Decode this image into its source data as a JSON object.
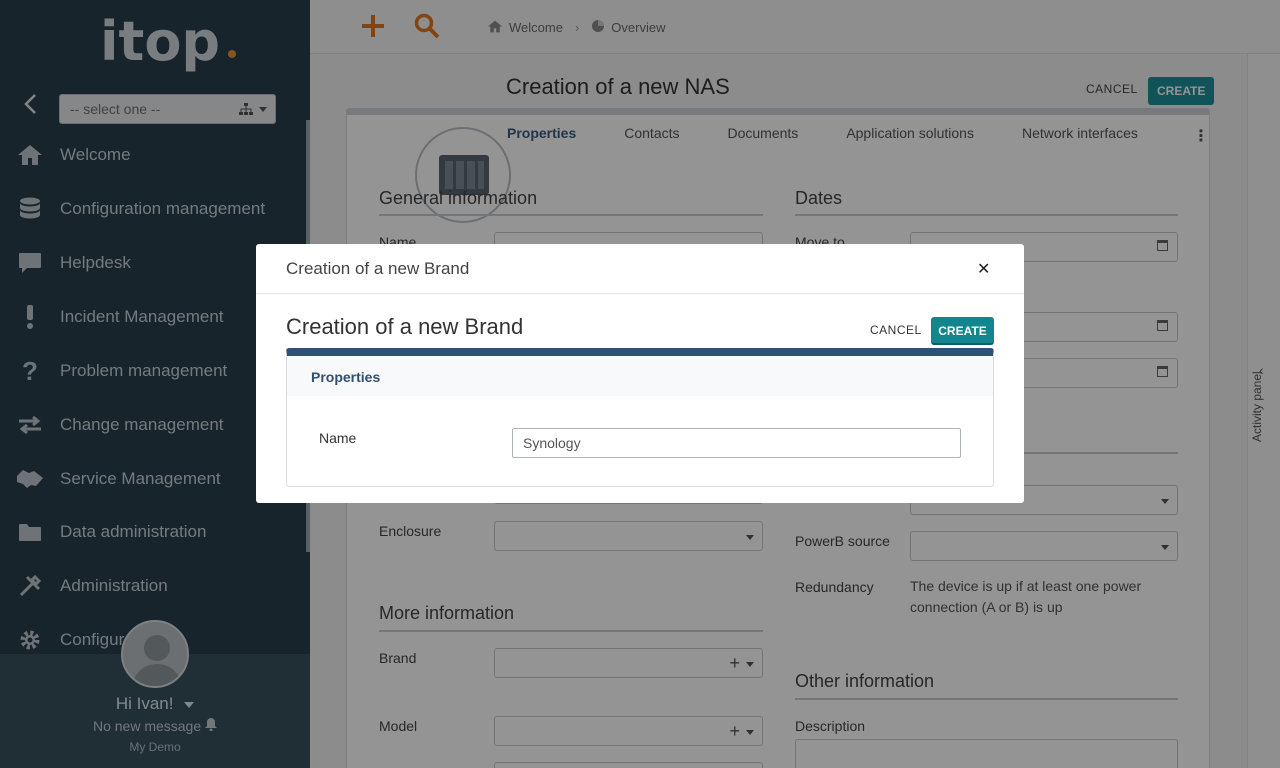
{
  "sidebar": {
    "logo_text": "itop",
    "org_select": "-- select one --",
    "menu": [
      {
        "label": "Welcome",
        "icon": "home-icon"
      },
      {
        "label": "Configuration management",
        "icon": "database-icon"
      },
      {
        "label": "Helpdesk",
        "icon": "chat-icon"
      },
      {
        "label": "Incident Management",
        "icon": "exclamation-icon"
      },
      {
        "label": "Problem management",
        "icon": "question-icon"
      },
      {
        "label": "Change management",
        "icon": "arrows-icon"
      },
      {
        "label": "Service Management",
        "icon": "handshake-icon"
      },
      {
        "label": "Data administration",
        "icon": "folder-icon"
      },
      {
        "label": "Administration",
        "icon": "tools-icon"
      },
      {
        "label": "Configur",
        "icon": "gear-icon"
      }
    ],
    "user": {
      "greeting": "Hi Ivan!",
      "messages": "No new message",
      "demo": "My Demo"
    }
  },
  "topbar": {
    "breadcrumbs": [
      "Welcome",
      "Overview"
    ]
  },
  "page": {
    "title": "Creation of a new NAS",
    "cancel": "CANCEL",
    "create": "CREATE",
    "tabs": [
      "Properties",
      "Contacts",
      "Documents",
      "Application solutions",
      "Network interfaces"
    ],
    "sections": {
      "general": "General information",
      "dates": "Dates",
      "more": "More information",
      "other": "Other information"
    },
    "fields": {
      "name": "Name",
      "move_to": "Move to",
      "enclosure": "Enclosure",
      "powerb": "PowerB source",
      "redundancy": "Redundancy",
      "redundancy_text": "The device is up if at least one power connection (A or B) is up",
      "brand": "Brand",
      "model": "Model",
      "description": "Description"
    }
  },
  "activity_panel": {
    "label": "Activity panel"
  },
  "modal": {
    "header": "Creation of a new Brand",
    "title": "Creation of a new Brand",
    "cancel": "CANCEL",
    "create": "CREATE",
    "tab": "Properties",
    "name_label": "Name",
    "name_value": "Synology"
  },
  "colors": {
    "sidebar_bg": "#2a3e4a",
    "accent_teal": "#11868f",
    "panel_blue": "#2f5274",
    "logo_orange": "#e8912d"
  }
}
